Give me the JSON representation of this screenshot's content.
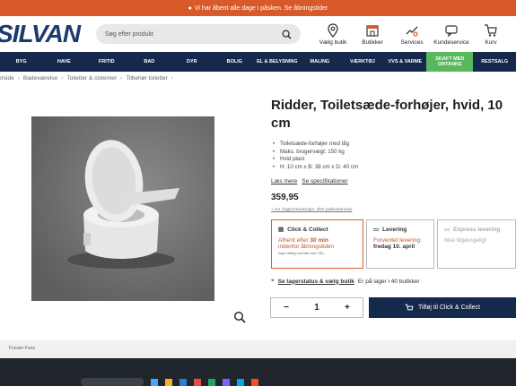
{
  "topbar": {
    "text": "Vi har åbent alle dage i påsken. Se åbningstider"
  },
  "header": {
    "logo": "SILVAN",
    "search_placeholder": "Søg efter produkt",
    "icons": [
      {
        "label": "Vælg butik",
        "icon": "location-pin-icon"
      },
      {
        "label": "Butikker",
        "icon": "store-icon"
      },
      {
        "label": "Services",
        "icon": "services-icon"
      },
      {
        "label": "Kundeservice",
        "icon": "chat-icon"
      },
      {
        "label": "Kurv",
        "icon": "cart-icon"
      }
    ]
  },
  "nav": [
    "BYG",
    "HAVE",
    "FRITID",
    "BAD",
    "DYR",
    "BOLIG",
    "EL & BELYSNING",
    "MALING",
    "VÆRKTØJ",
    "VVS & VARME",
    "SKAFT MED ONTANKE",
    "RESTSALG"
  ],
  "breadcrumbs": [
    "orside",
    "Badeværelse",
    "Toiletter & cisterner",
    "Tilbehør toiletter"
  ],
  "product": {
    "title": "Ridder, Toiletsæde-forhøjer, hvid, 10 cm",
    "bullets": [
      "Toiletsæde-forhøjer med låg",
      "Maks. brugervægt: 150 kg",
      "Hvid plast",
      "H: 10 cm x B: 38 cm x D: 40 cm"
    ],
    "read_more": "Læs mere",
    "specs": "Se specifikationer",
    "price": "359,95",
    "price_note": "+ evt. fragtomkostninger, efter pakkestørrelse"
  },
  "options": {
    "click": {
      "title": "Click & Collect",
      "line1": "Afhent efter ",
      "bold": "30 min",
      "line2": "indenfor åbningstiden",
      "small": "Ingen tillæg ved køb over 150,-"
    },
    "delivery": {
      "title": "Levering",
      "line1": "Forventet levering:",
      "date": "fredag 10. april"
    },
    "express": {
      "title": "Express levering",
      "line1": "Ikke tilgængeligt"
    }
  },
  "stock": {
    "link": "Se lagerstatus & vælg butik",
    "text": "Er på lager i 40 butikker"
  },
  "qty": {
    "minus": "−",
    "value": "1",
    "plus": "+"
  },
  "cart_button": "Tilføj til Click & Collect",
  "footer": "Fravær-Fane",
  "colors": {
    "brand": "#d85a2a",
    "navy": "#15294d",
    "green": "#58b85b"
  }
}
